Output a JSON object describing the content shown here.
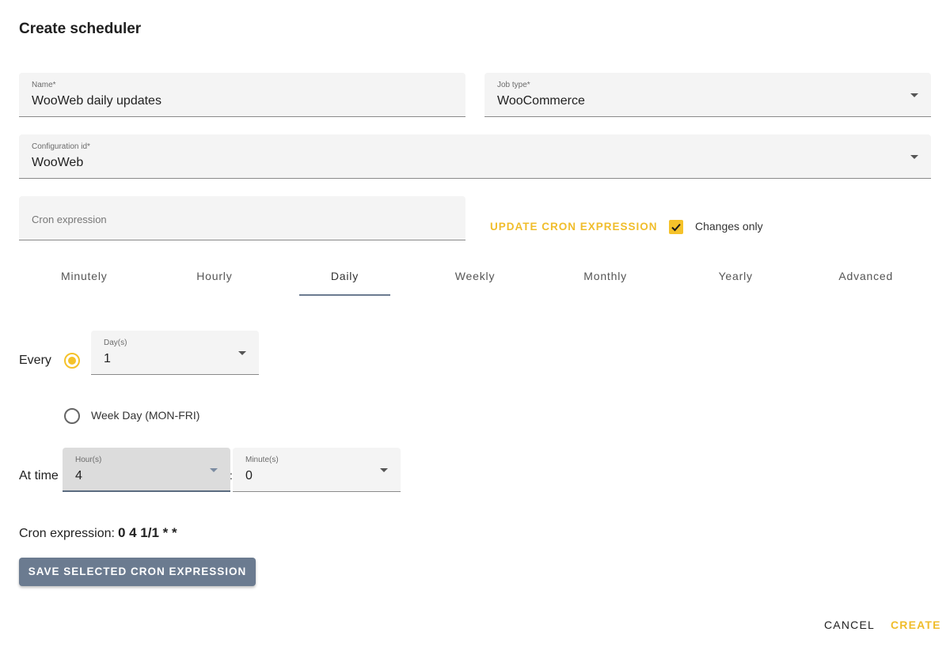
{
  "dialog": {
    "title": "Create scheduler"
  },
  "fields": {
    "name": {
      "label": "Name*",
      "value": "WooWeb daily updates"
    },
    "job_type": {
      "label": "Job type*",
      "value": "WooCommerce"
    },
    "configuration_id": {
      "label": "Configuration id*",
      "value": "WooWeb"
    },
    "cron_expression": {
      "placeholder": "Cron expression"
    }
  },
  "actions": {
    "update_cron": "UPDATE CRON EXPRESSION",
    "changes_only_label": "Changes only",
    "changes_only_checked": true
  },
  "tabs": [
    {
      "label": "Minutely"
    },
    {
      "label": "Hourly"
    },
    {
      "label": "Daily",
      "active": true
    },
    {
      "label": "Weekly"
    },
    {
      "label": "Monthly"
    },
    {
      "label": "Yearly"
    },
    {
      "label": "Advanced"
    }
  ],
  "daily": {
    "every_label": "Every",
    "days_label": "Day(s)",
    "days_value": "1",
    "weekday_label": "Week Day (MON-FRI)",
    "at_time_label": "At time",
    "hours_label": "Hour(s)",
    "hours_value": "4",
    "separator": ":",
    "minutes_label": "Minute(s)",
    "minutes_value": "0"
  },
  "cron": {
    "label": "Cron expression:",
    "value": "0 4 1/1 * *"
  },
  "buttons": {
    "save": "SAVE SELECTED CRON EXPRESSION",
    "cancel": "CANCEL",
    "create": "CREATE"
  },
  "colors": {
    "accent": "#f5c22a",
    "primary": "#6b7b90"
  }
}
